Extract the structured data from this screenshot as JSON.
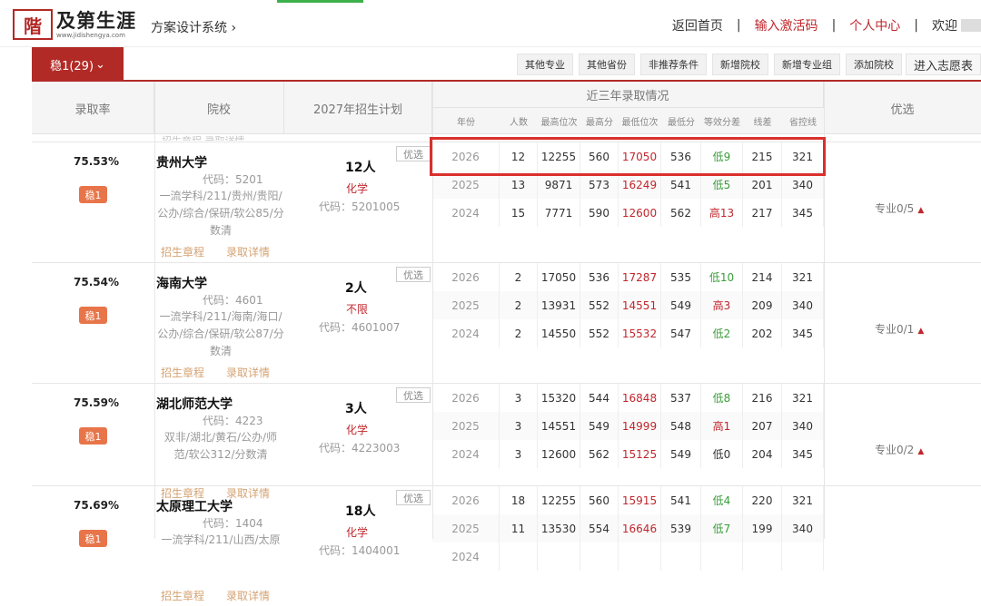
{
  "header": {
    "logo_seal": "階",
    "logo_text": "及第生涯",
    "logo_sub": "www.jidishengya.com",
    "system_name": "方案设计系统",
    "system_arrow": "›",
    "nav": {
      "home": "返回首页",
      "activate": "输入激活码",
      "personal": "个人中心",
      "welcome": "欢迎",
      "sep": "|"
    }
  },
  "tabs": {
    "main_tab": "稳1(29)",
    "main_tab_arrow": "⌄",
    "tools": [
      "其他专业",
      "其他省份",
      "非推荐条件",
      "新增院校",
      "新增专业组",
      "添加院校"
    ],
    "enter": "进入志愿表"
  },
  "columns": {
    "rate": "录取率",
    "school": "院校",
    "plan": "2027年招生计划",
    "recent": "近三年录取情况",
    "sub": [
      "年份",
      "人数",
      "最高位次",
      "最高分",
      "最低位次",
      "最低分",
      "等效分差",
      "线差",
      "省控线"
    ],
    "pref": "优选"
  },
  "ghost_text": "招生章程      录取详情",
  "rows": [
    {
      "rate": "75.53%",
      "badge": "稳1",
      "name": "贵州大学",
      "code": "代码：5201",
      "desc": "一流学科/211/贵州/贵阳/公办/综合/保研/软公85/分数清",
      "link1": "招生章程",
      "link2": "录取详情",
      "plan_count": "12人",
      "plan_subject": "化学",
      "plan_code": "代码：5201005",
      "pref_label": "优选",
      "prof": "专业0/5",
      "prof_tri": "▲",
      "data": [
        {
          "year": "2026",
          "num": "12",
          "hr": "12255",
          "hs": "560",
          "lr": "17050",
          "ls": "536",
          "diff": "低9",
          "dc": "g",
          "line": "215",
          "ctrl": "321"
        },
        {
          "year": "2025",
          "num": "13",
          "hr": "9871",
          "hs": "573",
          "lr": "16249",
          "ls": "541",
          "diff": "低5",
          "dc": "g",
          "line": "201",
          "ctrl": "340"
        },
        {
          "year": "2024",
          "num": "15",
          "hr": "7771",
          "hs": "590",
          "lr": "12600",
          "ls": "562",
          "diff": "高13",
          "dc": "r",
          "line": "217",
          "ctrl": "345"
        }
      ]
    },
    {
      "rate": "75.54%",
      "badge": "稳1",
      "name": "海南大学",
      "code": "代码：4601",
      "desc": "一流学科/211/海南/海口/公办/综合/保研/软公87/分数清",
      "link1": "招生章程",
      "link2": "录取详情",
      "plan_count": "2人",
      "plan_subject": "不限",
      "plan_code": "代码：4601007",
      "pref_label": "优选",
      "prof": "专业0/1",
      "prof_tri": "▲",
      "data": [
        {
          "year": "2026",
          "num": "2",
          "hr": "17050",
          "hs": "536",
          "lr": "17287",
          "ls": "535",
          "diff": "低10",
          "dc": "g",
          "line": "214",
          "ctrl": "321"
        },
        {
          "year": "2025",
          "num": "2",
          "hr": "13931",
          "hs": "552",
          "lr": "14551",
          "ls": "549",
          "diff": "高3",
          "dc": "r",
          "line": "209",
          "ctrl": "340"
        },
        {
          "year": "2024",
          "num": "2",
          "hr": "14550",
          "hs": "552",
          "lr": "15532",
          "ls": "547",
          "diff": "低2",
          "dc": "g",
          "line": "202",
          "ctrl": "345"
        }
      ]
    },
    {
      "rate": "75.59%",
      "badge": "稳1",
      "name": "湖北师范大学",
      "code": "代码：4223",
      "desc": "双非/湖北/黄石/公办/师范/软公312/分数清",
      "link1": "招生章程",
      "link2": "录取详情",
      "plan_count": "3人",
      "plan_subject": "化学",
      "plan_code": "代码：4223003",
      "pref_label": "优选",
      "prof": "专业0/2",
      "prof_tri": "▲",
      "data": [
        {
          "year": "2026",
          "num": "3",
          "hr": "15320",
          "hs": "544",
          "lr": "16848",
          "ls": "537",
          "diff": "低8",
          "dc": "g",
          "line": "216",
          "ctrl": "321"
        },
        {
          "year": "2025",
          "num": "3",
          "hr": "14551",
          "hs": "549",
          "lr": "14999",
          "ls": "548",
          "diff": "高1",
          "dc": "r",
          "line": "207",
          "ctrl": "340"
        },
        {
          "year": "2024",
          "num": "3",
          "hr": "12600",
          "hs": "562",
          "lr": "15125",
          "ls": "549",
          "diff": "低0",
          "dc": "k",
          "line": "204",
          "ctrl": "345"
        }
      ]
    },
    {
      "rate": "75.69%",
      "badge": "稳1",
      "name": "太原理工大学",
      "code": "代码：1404",
      "desc": "一流学科/211/山西/太原",
      "link1": "招生章程",
      "link2": "录取详情",
      "plan_count": "18人",
      "plan_subject": "化学",
      "plan_code": "代码：1404001",
      "pref_label": "优选",
      "prof": "",
      "prof_tri": "",
      "data": [
        {
          "year": "2026",
          "num": "18",
          "hr": "12255",
          "hs": "560",
          "lr": "15915",
          "ls": "541",
          "diff": "低4",
          "dc": "g",
          "line": "220",
          "ctrl": "321"
        },
        {
          "year": "2025",
          "num": "11",
          "hr": "13530",
          "hs": "554",
          "lr": "16646",
          "ls": "539",
          "diff": "低7",
          "dc": "g",
          "line": "199",
          "ctrl": "340"
        },
        {
          "year": "2024",
          "num": "",
          "hr": "",
          "hs": "",
          "lr": "",
          "ls": "",
          "diff": "",
          "dc": "k",
          "line": "",
          "ctrl": ""
        }
      ]
    }
  ]
}
